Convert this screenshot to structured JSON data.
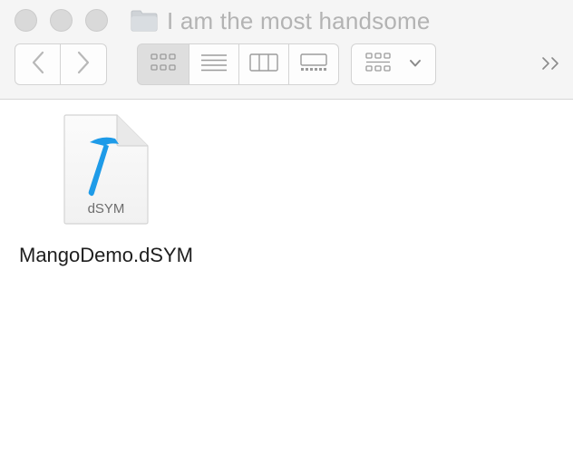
{
  "window": {
    "title": "I am the most handsome"
  },
  "toolbar": {
    "back_icon": "chevron-left-icon",
    "forward_icon": "chevron-right-icon",
    "view_modes": [
      "icon-view",
      "list-view",
      "column-view",
      "gallery-view"
    ],
    "active_view": "icon-view",
    "arrange_icon": "group-by-icon",
    "overflow_icon": "double-chevron-right-icon"
  },
  "files": [
    {
      "name": "MangoDemo.dSYM",
      "badge": "dSYM",
      "icon": "dsym-file-icon",
      "accent": "#1e9be8"
    }
  ]
}
